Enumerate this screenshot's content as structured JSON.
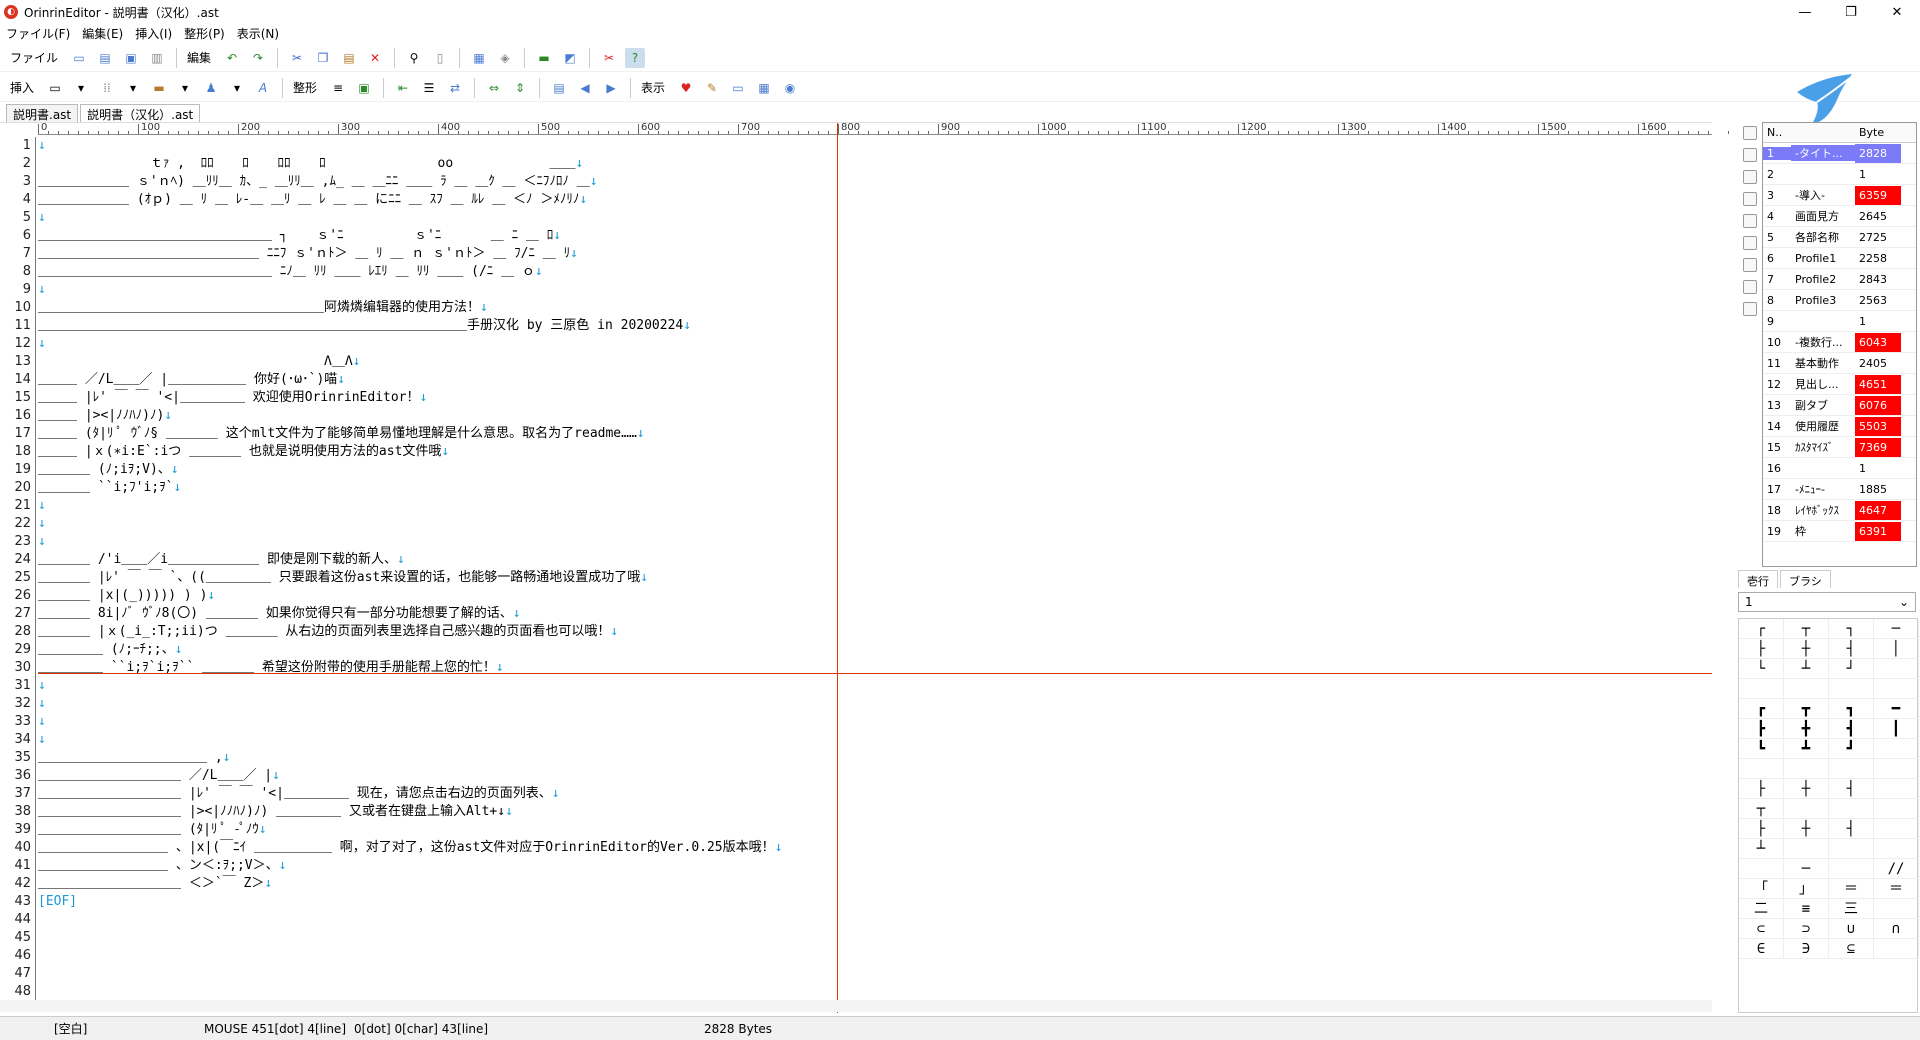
{
  "window": {
    "title": "OrinrinEditor - 説明書（汉化）.ast",
    "minimize": "—",
    "maximize": "❐",
    "close": "✕"
  },
  "menu": [
    "ファイル(F)",
    "編集(E)",
    "挿入(I)",
    "整形(P)",
    "表示(N)"
  ],
  "toolbar1": {
    "file_label": "ファイル",
    "edit_label": "編集"
  },
  "toolbar2": {
    "insert_label": "挿入",
    "shape_label": "整形",
    "view_label": "表示"
  },
  "tabs": [
    "説明書.ast",
    "説明書（汉化）.ast"
  ],
  "ruler_labels": [
    "0",
    "100",
    "200",
    "300",
    "400",
    "500",
    "600",
    "700",
    "800",
    "900",
    "1000",
    "1100",
    "1200",
    "1300",
    "1400",
    "1500",
    "1600"
  ],
  "lines": [
    {
      "t": ""
    },
    {
      "t": "　　　　　　　　 ｔｧ ,  ﾛﾛ 　 ﾛ 　 ﾛﾛ 　 ﾛ 　 　 　 　 　 oo 　　　 　 　 ＿＿"
    },
    {
      "t": "＿＿＿＿＿＿＿ ｓ'ｎﾍ) ＿ﾘﾘ＿ ｶ、_ ＿ﾘﾘ＿ ,ﾑ_ ＿ ＿ﾆﾆ ＿＿ ﾗ ＿ ＿ｸ ＿ ＜ﾆﾌﾉﾛﾉ ＿"
    },
    {
      "t": "＿＿＿＿＿＿＿ (ｵｐ) ＿ ﾘ ＿ ﾚ-＿ ＿ﾘ ＿ ﾚ ＿ ＿ にﾆﾆ ＿ ｽﾌ ＿ ﾙﾚ ＿ ＜ﾉ ＞ﾒﾉﾘﾉ"
    },
    {
      "t": ""
    },
    {
      "t": "＿＿＿＿＿＿＿＿＿＿＿＿＿＿＿＿＿＿ ┐ 　 ｓ'ﾆ 　 　 　 ｓ'ﾆ 　 　 ＿ ﾆ ＿ ﾛ"
    },
    {
      "t": "＿＿＿＿＿＿＿＿＿＿＿＿＿＿＿＿＿ ﾆﾆﾌ ｓ'ｎﾄ＞ ＿ ﾘ ＿ ｎ ｓ'ｎﾄ＞ ＿ ﾌ/ﾆ ＿ ﾘ"
    },
    {
      "t": "＿＿＿＿＿＿＿＿＿＿＿＿＿＿＿＿＿＿ ﾆﾉ＿ ﾘﾘ ＿＿ ﾚｴﾘ ＿ ﾘﾘ ＿＿ (/ﾆ ＿ ｏ"
    },
    {
      "t": ""
    },
    {
      "t": "＿＿＿＿＿＿＿＿＿＿＿＿＿＿＿＿＿＿＿＿＿＿阿燐燐编辑器的使用方法！"
    },
    {
      "t": "＿＿＿＿＿＿＿＿＿＿＿＿＿＿＿＿＿＿＿＿＿＿＿＿＿＿＿＿＿＿＿＿＿手册汉化 by 三原色 in 20200224"
    },
    {
      "t": ""
    },
    {
      "t": "　　　　　　　　　　　　　　　　　　　　　　Λ＿Λ"
    },
    {
      "t": "＿＿＿ ／/L＿＿／ |＿＿＿＿＿＿ 你好(･ω･`)喵"
    },
    {
      "t": "＿＿＿ |ﾚ' ￣ ￣ '<|＿＿＿＿＿ 欢迎使用OrinrinEditor！"
    },
    {
      "t": "＿＿＿ |><|ﾉﾉﾊﾉ)ﾉ)"
    },
    {
      "t": "＿＿＿ (ﾀ|ﾘ ﾟ ｳﾞﾉ§ ＿＿＿＿ 这个mlt文件为了能够简单易懂地理解是什么意思。取名为了readme……"
    },
    {
      "t": "＿＿＿ |ｘ(∗i:E`:iつ ＿＿＿＿ 也就是说明使用方法的ast文件哦"
    },
    {
      "t": "＿＿＿＿ (ﾉ;iｦ;V)、"
    },
    {
      "t": "＿＿＿＿ ``i;ﾌ'i;ｦ`"
    },
    {
      "t": ""
    },
    {
      "t": ""
    },
    {
      "t": ""
    },
    {
      "t": "＿＿＿＿ /'i＿＿／i＿＿＿＿＿＿＿ 即使是刚下载的新人、"
    },
    {
      "t": "＿＿＿＿ |ﾚ' ￣ ￣ `、((＿＿＿＿＿ 只要跟着这份ast来设置的话，也能够一路畅通地设置成功了哦"
    },
    {
      "t": "＿＿＿＿ |x|(_))))) ) )"
    },
    {
      "t": "＿＿＿＿ 8i|ﾉﾞ ｳﾞﾉ8(〇) ＿＿＿＿ 如果你觉得只有一部分功能想要了解的话、"
    },
    {
      "t": "＿＿＿＿ |ｘ(_i_:T;;ii)つ ＿＿＿＿ 从右边的页面列表里选择自己感兴趣的页面看也可以哦！"
    },
    {
      "t": "＿＿＿＿＿ (ﾉ;ｰﾁ;;、"
    },
    {
      "t": "＿＿＿＿＿ ``i;ｦ`i;ｦ`` ＿＿＿＿ 希望这份附带的使用手册能帮上您的忙！"
    },
    {
      "t": ""
    },
    {
      "t": ""
    },
    {
      "t": ""
    },
    {
      "t": ""
    },
    {
      "t": "＿＿＿＿＿＿＿＿＿＿＿＿＿ ,"
    },
    {
      "t": "＿＿＿＿＿＿＿＿＿＿＿ ／/L＿＿／ |"
    },
    {
      "t": "＿＿＿＿＿＿＿＿＿＿＿ |ﾚ' ￣ ￣ '<|＿＿＿＿＿ 现在，请您点击右边的页面列表、"
    },
    {
      "t": "＿＿＿＿＿＿＿＿＿＿＿ |><|ﾉﾉﾊﾉ)ﾉ) ＿＿＿＿＿ 又或者在键盘上输入Alt+↓"
    },
    {
      "t": "＿＿＿＿＿＿＿＿＿＿＿ (ﾀ|ﾘ ﾟ -ﾟﾉｳ"
    },
    {
      "t": "＿＿＿＿＿＿＿＿＿＿ 、|x|(￣ﾆｲ ＿＿＿＿＿＿ 啊，对了对了，这份ast文件对应于OrinrinEditor的Ver.0.25版本哦！"
    },
    {
      "t": "＿＿＿＿＿＿＿＿＿＿ 、ン＜:ｦ;;V＞、"
    },
    {
      "t": "＿＿＿＿＿＿＿＿＿＿＿ ＜＞`￣ Z＞"
    },
    {
      "t": "[EOF]"
    }
  ],
  "line_count": 48,
  "page_list": {
    "headers": [
      "N..",
      "",
      "Byte"
    ],
    "rows": [
      {
        "n": "1",
        "name": "-タイト...",
        "byte": "2828",
        "red": false,
        "sel": true
      },
      {
        "n": "2",
        "name": "",
        "byte": "1",
        "red": false,
        "sel": false
      },
      {
        "n": "3",
        "name": "-導入-",
        "byte": "6359",
        "red": true,
        "sel": false
      },
      {
        "n": "4",
        "name": "画面見方",
        "byte": "2645",
        "red": false,
        "sel": false
      },
      {
        "n": "5",
        "name": "各部名称",
        "byte": "2725",
        "red": false,
        "sel": false
      },
      {
        "n": "6",
        "name": "Profile1",
        "byte": "2258",
        "red": false,
        "sel": false
      },
      {
        "n": "7",
        "name": "Profile2",
        "byte": "2843",
        "red": false,
        "sel": false
      },
      {
        "n": "8",
        "name": "Profile3",
        "byte": "2563",
        "red": false,
        "sel": false
      },
      {
        "n": "9",
        "name": "",
        "byte": "1",
        "red": false,
        "sel": false
      },
      {
        "n": "10",
        "name": "-複数行...",
        "byte": "6043",
        "red": true,
        "sel": false
      },
      {
        "n": "11",
        "name": "基本動作",
        "byte": "2405",
        "red": false,
        "sel": false
      },
      {
        "n": "12",
        "name": "見出し...",
        "byte": "4651",
        "red": true,
        "sel": false
      },
      {
        "n": "13",
        "name": "副タブ",
        "byte": "6076",
        "red": true,
        "sel": false
      },
      {
        "n": "14",
        "name": "使用履歴",
        "byte": "5503",
        "red": true,
        "sel": false
      },
      {
        "n": "15",
        "name": "ｶｽﾀﾏｲｽﾞ",
        "byte": "7369",
        "red": true,
        "sel": false
      },
      {
        "n": "16",
        "name": "",
        "byte": "1",
        "red": false,
        "sel": false
      },
      {
        "n": "17",
        "name": "-ﾒﾆｭｰ-",
        "byte": "1885",
        "red": false,
        "sel": false
      },
      {
        "n": "18",
        "name": "ﾚｲﾔﾎﾞｯｸｽ",
        "byte": "4647",
        "red": true,
        "sel": false
      },
      {
        "n": "19",
        "name": "枠",
        "byte": "6391",
        "red": true,
        "sel": false
      }
    ]
  },
  "palette": {
    "tabs": [
      "壱行",
      "ブラシ"
    ],
    "selected": "1",
    "cells": [
      "┌",
      "┬",
      "┐",
      "─",
      "├",
      "┼",
      "┤",
      "│",
      "└",
      "┴",
      "┘",
      "",
      "",
      "",
      "",
      "",
      "┏",
      "┳",
      "┓",
      "━",
      "┣",
      "╋",
      "┫",
      "┃",
      "┗",
      "┻",
      "┛",
      "",
      "",
      "",
      "",
      "",
      "├",
      "┼",
      "┤",
      "",
      "┬",
      "",
      "",
      "",
      "├",
      "┼",
      "┤",
      "",
      "┴",
      "",
      "",
      "",
      "",
      "─",
      "",
      "//",
      "「",
      "」",
      "＝",
      "＝",
      "二",
      "≡",
      "三",
      "",
      "⊂",
      "⊃",
      "∪",
      "∩",
      "∈",
      "∋",
      "⊆",
      ""
    ]
  },
  "status": {
    "mode": "[空白]",
    "mouse": "MOUSE 451[dot] 4[line]",
    "caret": "0[dot] 0[char] 43[line]",
    "bytes": "2828 Bytes"
  }
}
